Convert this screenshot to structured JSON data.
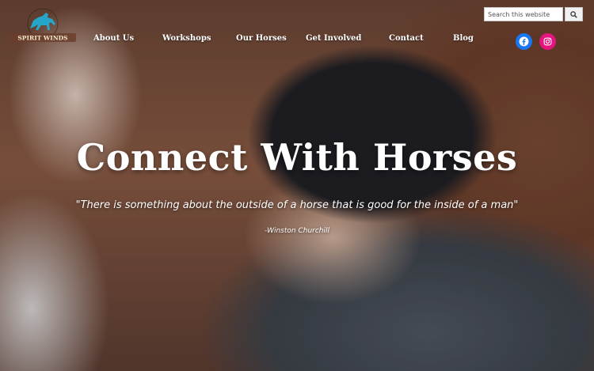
{
  "brand": {
    "logo_text": "SPIRIT WINDS",
    "logo_icon": "horse-icon"
  },
  "nav": {
    "items": [
      {
        "label": "About Us"
      },
      {
        "label": "Workshops"
      },
      {
        "label": "Our Horses"
      },
      {
        "label": "Get Involved"
      },
      {
        "label": "Contact"
      },
      {
        "label": "Blog"
      }
    ]
  },
  "search": {
    "placeholder": "Search this website",
    "value": "",
    "button_icon": "search-icon"
  },
  "social": {
    "facebook": {
      "icon": "facebook-icon",
      "color": "#1877f2"
    },
    "instagram": {
      "icon": "instagram-icon",
      "color": "#e4157e"
    }
  },
  "hero": {
    "headline": "Connect With Horses",
    "quote": "\"There is something about the outside of a horse that is good for the inside of a man\"",
    "attribution": "-Winston Churchill"
  }
}
